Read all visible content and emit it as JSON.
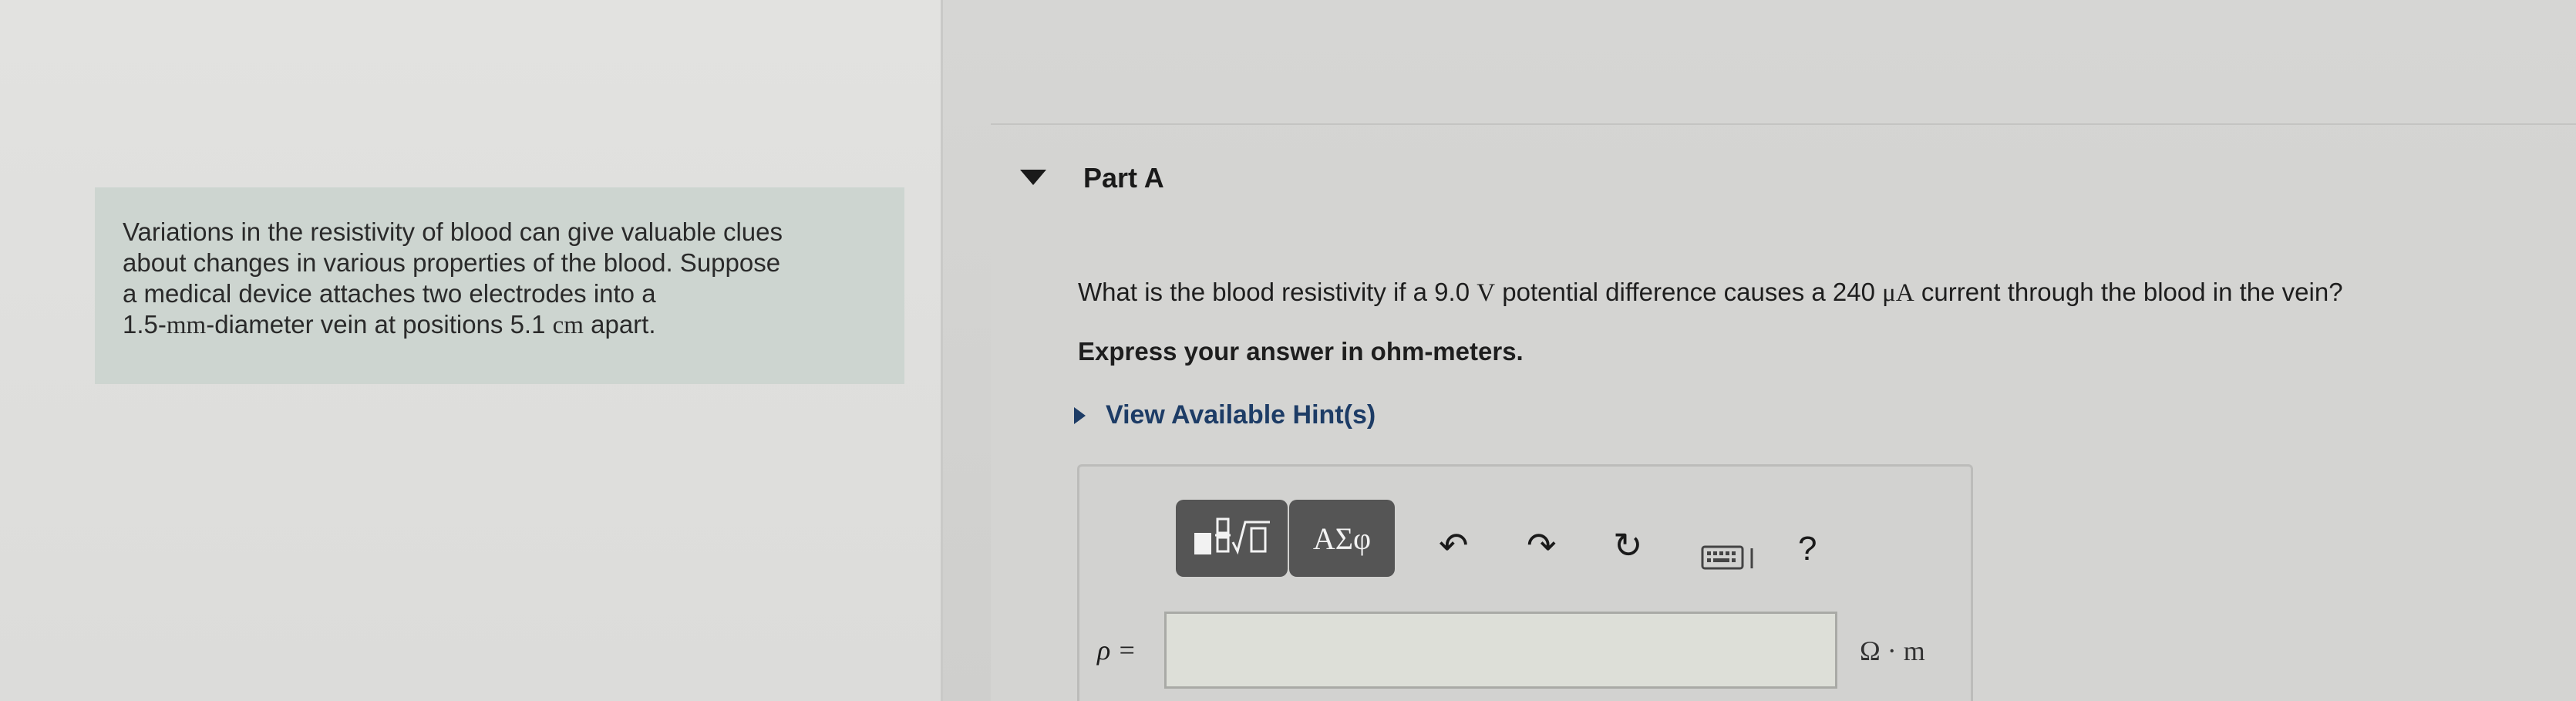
{
  "problem": {
    "line1": "Variations in the resistivity of blood can give valuable clues",
    "line2": "about changes in various properties of the blood. Suppose",
    "line3": "a medical device attaches two electrodes into a",
    "line4_value": "1.5-",
    "line4_unit": "mm",
    "line4_rest": "-diameter vein at positions 5.1 ",
    "line4_unit2": "cm",
    "line4_end": " apart."
  },
  "part": {
    "title": "Part A",
    "question_pre": "What is the blood resistivity if a 9.0 ",
    "question_unit1": "V",
    "question_mid": " potential difference causes a 240 ",
    "question_unit2": "μA",
    "question_post": " current through the blood in the vein?",
    "instruction": "Express your answer in ohm-meters.",
    "hints_label": "View Available Hint(s)"
  },
  "toolbar": {
    "symbols_label": "ΑΣφ",
    "undo_icon": "↶",
    "redo_icon": "↷",
    "reset_icon": "↻",
    "help_icon": "?"
  },
  "answer": {
    "variable_label": "ρ =",
    "value": "",
    "unit": "Ω · m"
  },
  "colors": {
    "problem_box": "#cdd5d0",
    "toolbar_button": "#555555",
    "hint_link": "#1d3c66"
  }
}
